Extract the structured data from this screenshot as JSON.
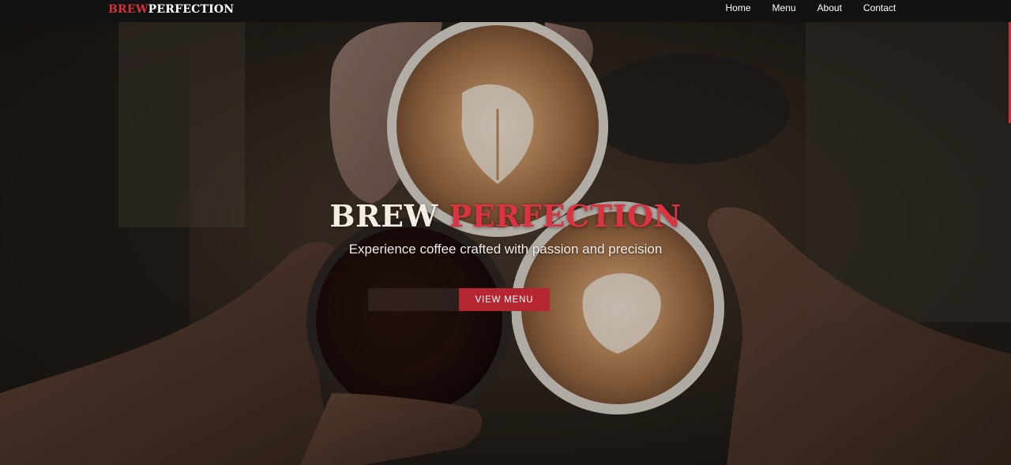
{
  "brand": {
    "logo_accent": "BREW",
    "logo_main": "PERFECTION",
    "accent_color": "#d3313d"
  },
  "nav": {
    "items": [
      {
        "label": "Home"
      },
      {
        "label": "Menu"
      },
      {
        "label": "About"
      },
      {
        "label": "Contact"
      }
    ]
  },
  "hero": {
    "title_part1": "BREW",
    "title_part2": "PERFECTION",
    "subtitle": "Experience coffee crafted with passion and precision",
    "primary_button": "VIEW MENU",
    "background_image": "four hands clinking coffee cups with latte art"
  }
}
